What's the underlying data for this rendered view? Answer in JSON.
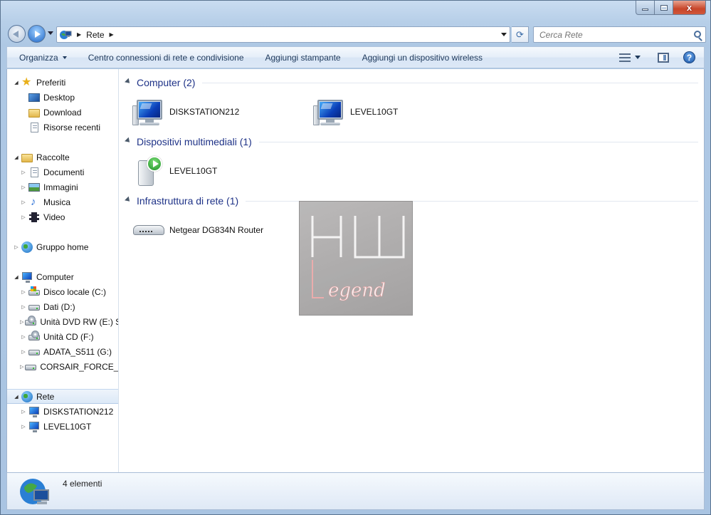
{
  "window": {
    "minimize_symbol": "",
    "close_symbol": "x"
  },
  "address_bar": {
    "crumbs": [
      "Rete"
    ],
    "search_placeholder": "Cerca Rete"
  },
  "command_bar": {
    "organize": "Organizza",
    "network_center": "Centro connessioni di rete e condivisione",
    "add_printer": "Aggiungi stampante",
    "add_wireless": "Aggiungi un dispositivo wireless",
    "help": "?"
  },
  "nav_pane": {
    "favorites": {
      "label": "Preferiti",
      "items": [
        "Desktop",
        "Download",
        "Risorse recenti"
      ]
    },
    "libraries": {
      "label": "Raccolte",
      "items": [
        "Documenti",
        "Immagini",
        "Musica",
        "Video"
      ]
    },
    "homegroup": {
      "label": "Gruppo home"
    },
    "computer": {
      "label": "Computer",
      "items": [
        "Disco locale (C:)",
        "Dati (D:)",
        "Unità DVD RW (E:) Sy",
        "Unità CD (F:)",
        "ADATA_S511 (G:)",
        "CORSAIR_FORCE_GT"
      ]
    },
    "network": {
      "label": "Rete",
      "items": [
        "DISKSTATION212",
        "LEVEL10GT"
      ]
    }
  },
  "content": {
    "groups": [
      {
        "title": "Computer (2)",
        "items": [
          "DISKSTATION212",
          "LEVEL10GT"
        ]
      },
      {
        "title": "Dispositivi multimediali (1)",
        "items": [
          "LEVEL10GT"
        ]
      },
      {
        "title": "Infrastruttura di rete (1)",
        "items": [
          "Netgear DG834N Router"
        ]
      }
    ]
  },
  "watermark": {
    "line1": "HW",
    "line2": "Legend"
  },
  "details": {
    "count": "4 elementi"
  },
  "icons": {
    "favorites": "star-icon",
    "desktop": "desktop-icon",
    "download": "download-folder-icon",
    "recent": "recent-places-icon",
    "libraries": "libraries-icon",
    "homegroup": "homegroup-icon",
    "network": "network-icon",
    "computer": "computer-icon",
    "router": "router-icon",
    "media": "media-device-icon"
  }
}
